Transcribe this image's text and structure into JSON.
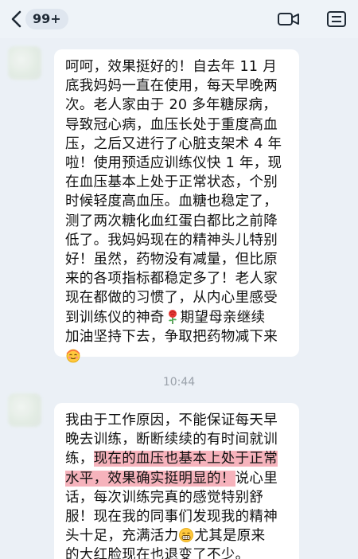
{
  "header": {
    "unread_count": "99+",
    "back_icon": "chevron-left-icon",
    "video_icon": "video-call-icon",
    "menu_icon": "list-menu-icon"
  },
  "messages": [
    {
      "lines": [
        "呵呵，效果挺好的！自去年 11 月",
        "底我妈妈一直在使用，每天早晚两",
        "次。老人家由于 20 多年糖尿病，",
        "导致冠心病，血压长处于重度高血",
        "压，之后又进行了心脏支架术 4 年",
        "啦！使用预适应训练仪快 1 年，现",
        "在血压基本上处于正常状态，个别",
        "时候轻度高血压。血糖也稳定了，",
        "测了两次糖化血红蛋白都比之前降",
        "低了。我妈妈现在的精神头儿特别",
        "好！虽然，药物没有减量，但比原",
        "来的各项指标都稳定多了！老人家",
        "现在都做的习惯了，从内心里感受",
        "到训练仪的神奇",
        "期望母亲继续",
        "加油坚持下去，争取把药物减下来"
      ],
      "emojis": [
        "rose",
        "blessed-face"
      ]
    },
    {
      "timestamp": "10:44",
      "lines": [
        "我由于工作原因，不能保证每天早",
        "晚去训练，断断续续的有时间就训",
        "练，",
        "现在的血压也基本上处于正常",
        "水平，效果确实挺明显的！",
        "说心里",
        "话，每次训练完真的感觉特别舒",
        "服！现在我的同事们发现我的精神",
        "头十足，充满活力",
        "尤其是原来",
        "的大红脸现在也退变了不少。"
      ],
      "emojis": [
        "grinning-face"
      ],
      "highlight_color": "#f6b3bc"
    }
  ]
}
